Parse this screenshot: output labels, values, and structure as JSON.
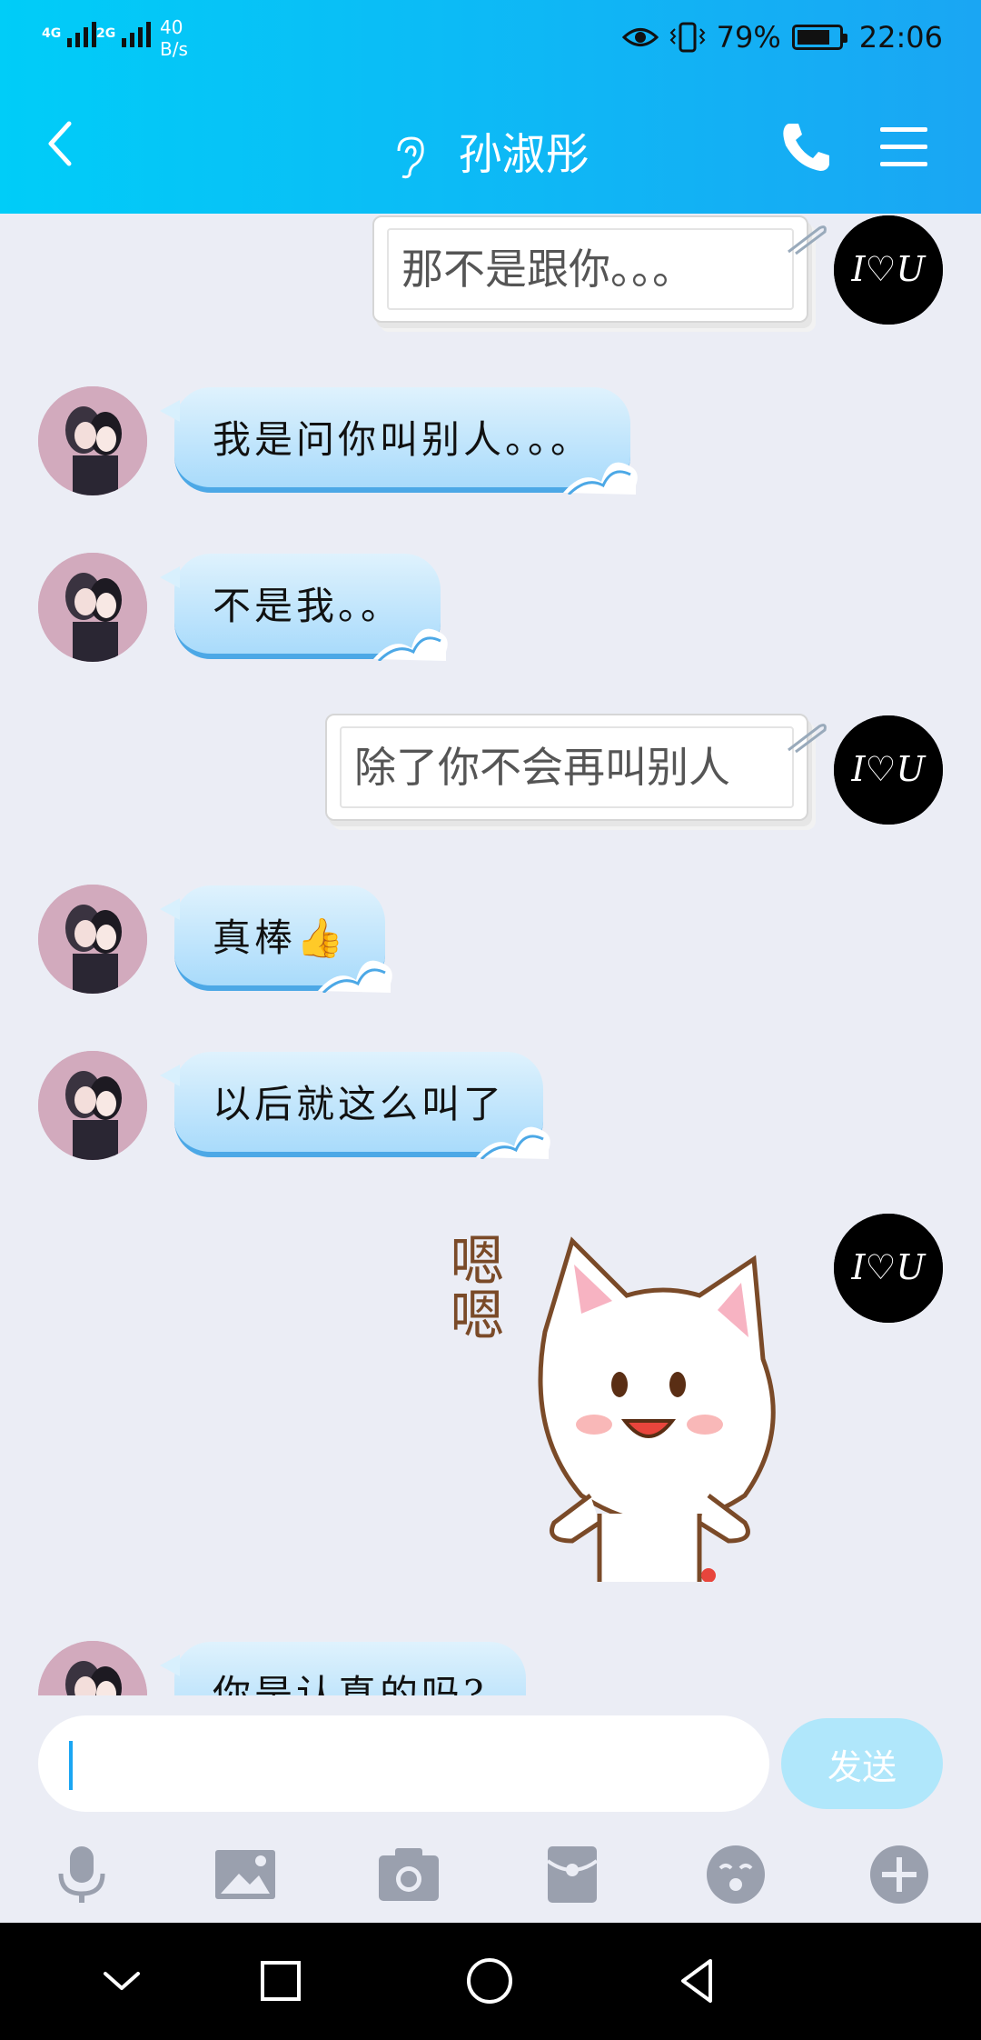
{
  "status_bar": {
    "signal_1": "4G",
    "signal_2": "2G",
    "net_speed_value": "40",
    "net_speed_unit": "B/s",
    "battery": "79%",
    "time": "22:06"
  },
  "header": {
    "title": "孙淑彤"
  },
  "messages": [
    {
      "side": "me",
      "text": "那不是跟你。。。"
    },
    {
      "side": "them",
      "text": "我是问你叫别人。。。"
    },
    {
      "side": "them",
      "text": "不是我。。"
    },
    {
      "side": "me",
      "text": "除了你不会再叫别人"
    },
    {
      "side": "them",
      "text": "真棒👍"
    },
    {
      "side": "them",
      "text": "以后就这么叫了"
    },
    {
      "side": "me",
      "sticker_text": "嗯嗯"
    },
    {
      "side": "them",
      "text": "你是认真的吗?"
    }
  ],
  "input": {
    "value": "",
    "send_label": "发送"
  },
  "colors": {
    "header_start": "#00cdf8",
    "header_end": "#1aa6f3",
    "send_button": "#b0e7fb",
    "chat_bg": "#ebedf5"
  },
  "icons": {
    "back": "chevron-left-icon",
    "ear": "ear-icon",
    "phone": "phone-icon",
    "menu": "hamburger-menu-icon",
    "mic": "microphone-icon",
    "image": "image-icon",
    "camera": "camera-icon",
    "red_packet": "red-packet-icon",
    "emoji": "emoji-icon",
    "plus": "plus-icon"
  }
}
